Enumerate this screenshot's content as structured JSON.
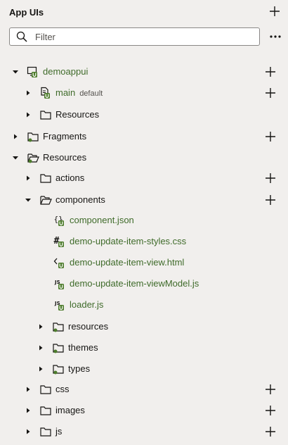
{
  "header": {
    "title": "App UIs"
  },
  "filter": {
    "placeholder": "Filter"
  },
  "colors": {
    "green": "#3f6b2a",
    "badge_green": "#4d7c2c",
    "text": "#161513"
  },
  "tree": {
    "demoappui": "demoappui",
    "main": "main",
    "main_default": "default",
    "resources_app": "Resources",
    "fragments": "Fragments",
    "resources": "Resources",
    "actions": "actions",
    "components": "components",
    "component_json": "component.json",
    "styles_css": "demo-update-item-styles.css",
    "view_html": "demo-update-item-view.html",
    "viewmodel_js": "demo-update-item-viewModel.js",
    "loader_js": "loader.js",
    "resources_sub": "resources",
    "themes": "themes",
    "types": "types",
    "css": "css",
    "images": "images",
    "js": "js"
  }
}
